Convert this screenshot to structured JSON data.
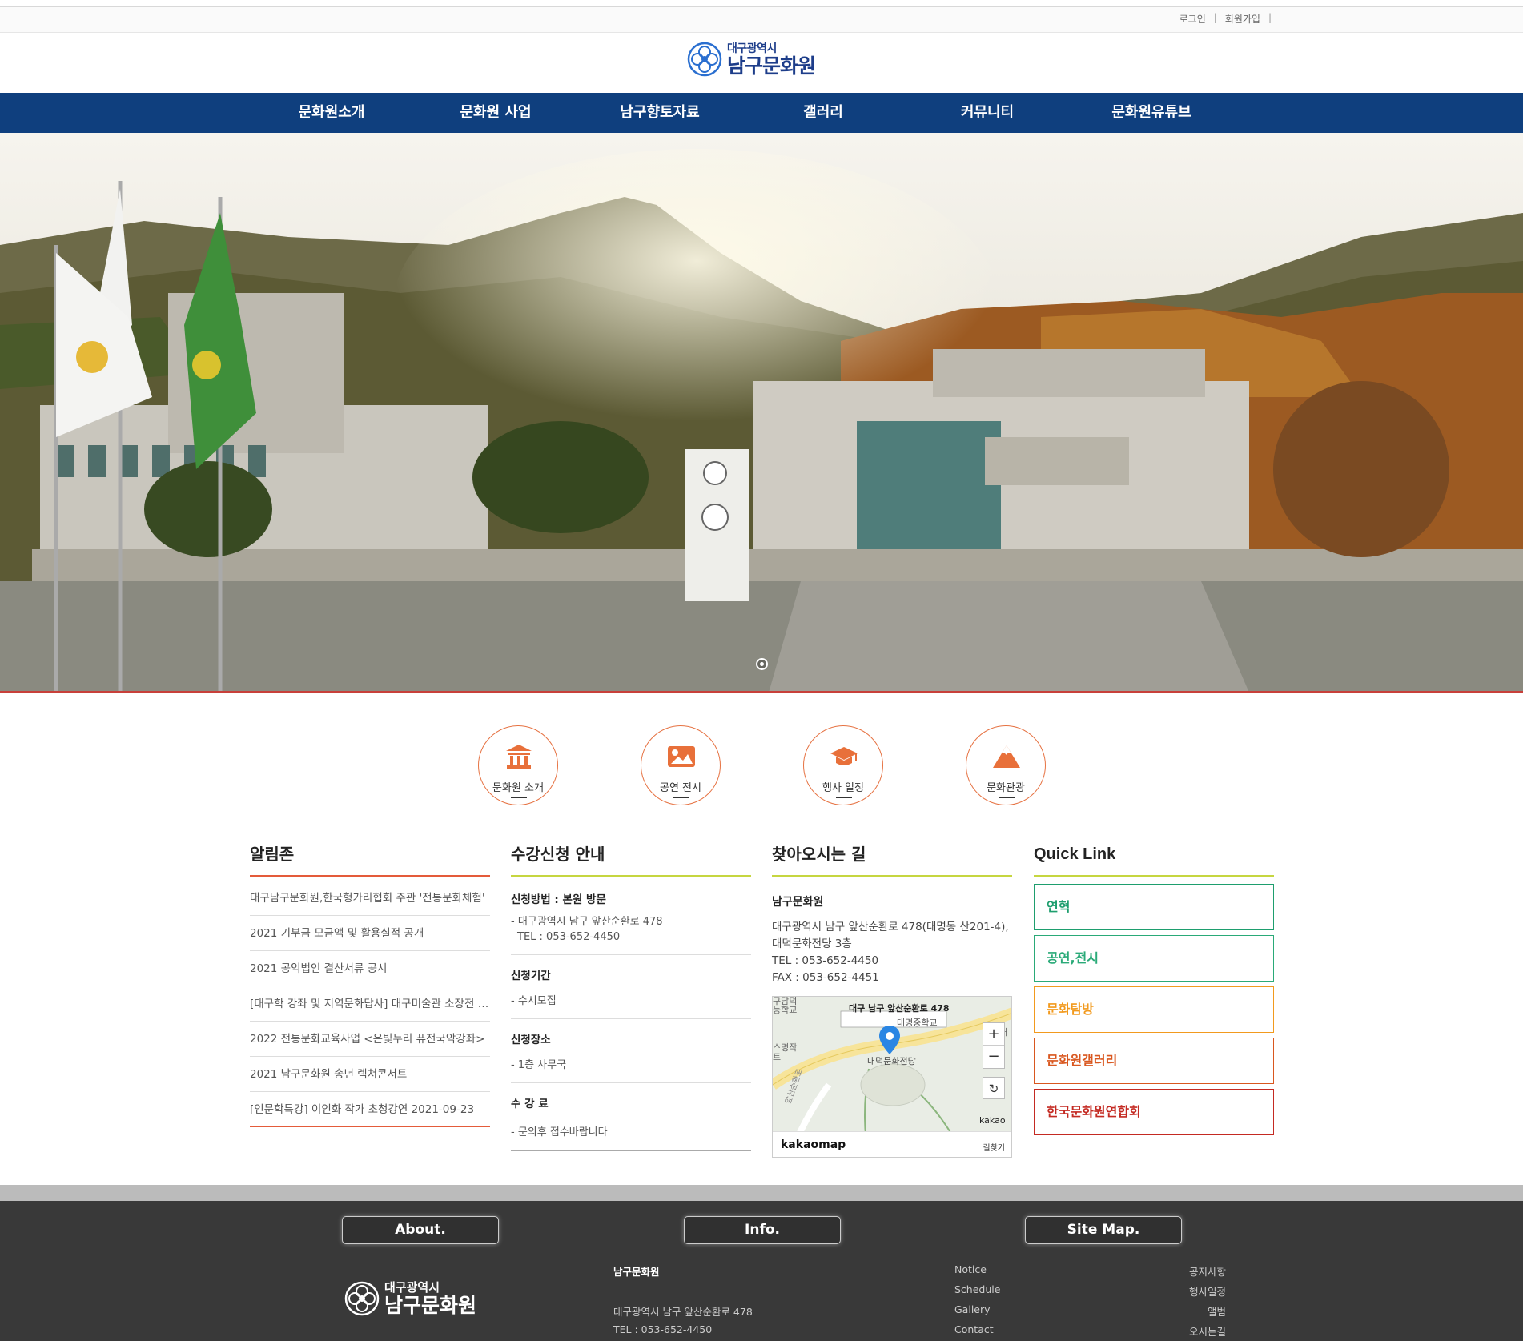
{
  "utility": {
    "login": "로그인",
    "join": "회원가입"
  },
  "logo": {
    "small": "대구광역시",
    "big": "남구문화원"
  },
  "nav": [
    "문화원소개",
    "문화원 사업",
    "남구향토자료",
    "갤러리",
    "커뮤니티",
    "문화원유튜브"
  ],
  "icons": [
    "문화원 소개",
    "공연 전시",
    "행사 일정",
    "문화관광"
  ],
  "notice": {
    "title": "알림존",
    "items": [
      "대구남구문화원,한국헝가리협회 주관 '전통문화체험'",
      "2021 기부금 모금액 및 활용실적 공개",
      "2021 공익법인 결산서류 공시",
      "[대구학 강좌 및 지역문화답사] 대구미술관 소장전 관람",
      "2022 전통문화교육사업 <은빛누리 퓨전국악강좌>",
      "2021 남구문화원 송년 렉쳐콘서트",
      "[인문학특강] 이인화 작가 초청강연 2021-09-23"
    ]
  },
  "course": {
    "title": "수강신청 안내",
    "method_label": "신청방법 : 본원 방문",
    "method_addr": "- 대구광역시 남구 앞산순환로 478",
    "method_tel": "TEL : 053-652-4450",
    "period_label": "신청기간",
    "period_val": "- 수시모집",
    "place_label": "신청장소",
    "place_val": "- 1층 사무국",
    "fee_label": "수 강 료",
    "fee_val": "- 문의후 접수바랍니다"
  },
  "directions": {
    "title": "찾아오시는 길",
    "name": "남구문화원",
    "addr1": "대구광역시 남구 앞산순환로 478(대명동 산201-4),",
    "addr2": "대덕문화전당 3층",
    "tel": "TEL : 053-652-4450",
    "fax": "FAX : 053-652-4451",
    "map": {
      "callout": "대구 남구 앞산순환로 478",
      "place": "대덕문화전당",
      "school": "대명중학교",
      "school_left1": "구담덕",
      "school_left2": "등학교",
      "left_label1": "스명작",
      "left_label2": "트",
      "road_label": "앞산순환로",
      "right_label": "대",
      "zoom_in": "+",
      "zoom_out": "−",
      "refresh": "↻",
      "kakao": "kakao",
      "brand": "kakaomap",
      "route": "길찾기"
    }
  },
  "quicklink": {
    "title": "Quick Link",
    "items": [
      {
        "label": "연혁",
        "color": "#1e9e6e"
      },
      {
        "label": "공연,전시",
        "color": "#2aaa78"
      },
      {
        "label": "문화탐방",
        "color": "#f29a1e"
      },
      {
        "label": "문화원갤러리",
        "color": "#d9571f"
      },
      {
        "label": "한국문화원연합회",
        "color": "#c42a22"
      }
    ]
  },
  "footer": {
    "about": "About.",
    "info": "Info.",
    "sitemap": "Site Map.",
    "logo_small": "대구광역시",
    "logo_big": "남구문화원",
    "org": "남구문화원",
    "address": "대구광역시 남구 앞산순환로 478",
    "tel": "TEL : 053-652-4450",
    "links_en": [
      "Notice",
      "Schedule",
      "Gallery",
      "Contact"
    ],
    "links_ko": [
      "공지사항",
      "행사일정",
      "앨범",
      "오시는길"
    ]
  }
}
